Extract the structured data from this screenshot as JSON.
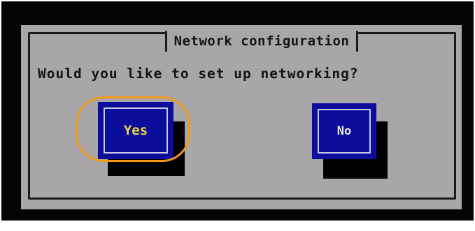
{
  "dialog": {
    "title": "Network configuration",
    "question": "Would you like to set up networking?"
  },
  "buttons": {
    "yes_label": "Yes",
    "no_label": "No",
    "focused": "Yes"
  },
  "colors": {
    "background": "#050505",
    "panel": "#a8a6a8",
    "button": "#0d0d9c",
    "focused_text": "#f0d840",
    "highlight_ring": "#f39a1c"
  }
}
